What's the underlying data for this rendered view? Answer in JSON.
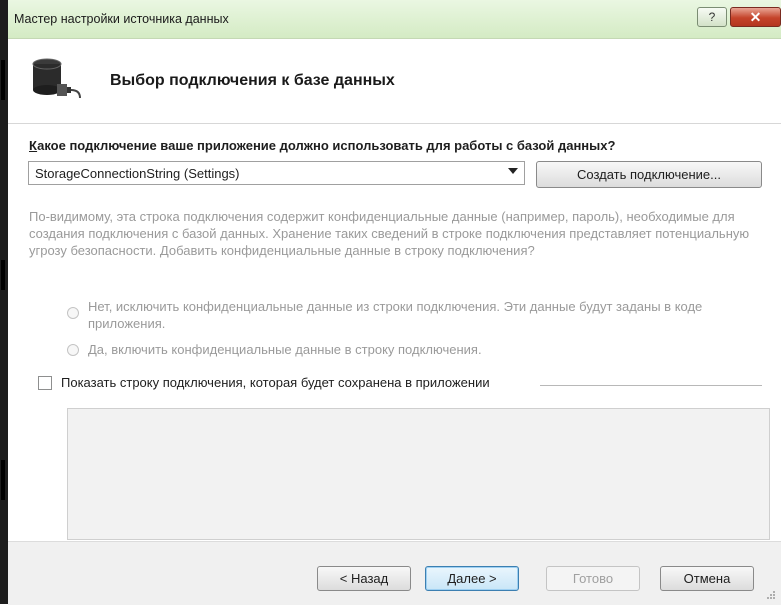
{
  "window": {
    "title": "Мастер настройки источника данных",
    "help_glyph": "?",
    "close_glyph": "✕"
  },
  "header": {
    "title": "Выбор подключения к базе данных",
    "icon": "database-connection-icon"
  },
  "connection": {
    "question_first_letter": "К",
    "question_rest": "акое подключение ваше приложение должно использовать для работы с базой данных?",
    "selected": "StorageConnectionString (Settings)",
    "new_button": "Создать подключение..."
  },
  "warning": {
    "text": "По-видимому, эта строка подключения содержит конфиденциальные данные (например, пароль), необходимые для создания подключения с базой данных. Хранение таких сведений в строке подключения представляет потенциальную угрозу безопасности. Добавить конфиденциальные данные в строку подключения?",
    "option_no": "Нет, исключить конфиденциальные данные из строки подключения. Эти данные будут заданы в коде приложения.",
    "option_yes": "Да, включить конфиденциальные данные в строку подключения."
  },
  "show_string": {
    "label": "Показать строку подключения, которая будет сохранена в приложении",
    "checked": false,
    "value": ""
  },
  "footer": {
    "back": "< Назад",
    "next": "Далее >",
    "finish": "Готово",
    "cancel": "Отмена"
  },
  "colors": {
    "titlebar": "#d4ebc4",
    "close_button": "#c4432a",
    "disabled_text": "#9a9a9a",
    "default_button_border": "#3c7fb1"
  }
}
